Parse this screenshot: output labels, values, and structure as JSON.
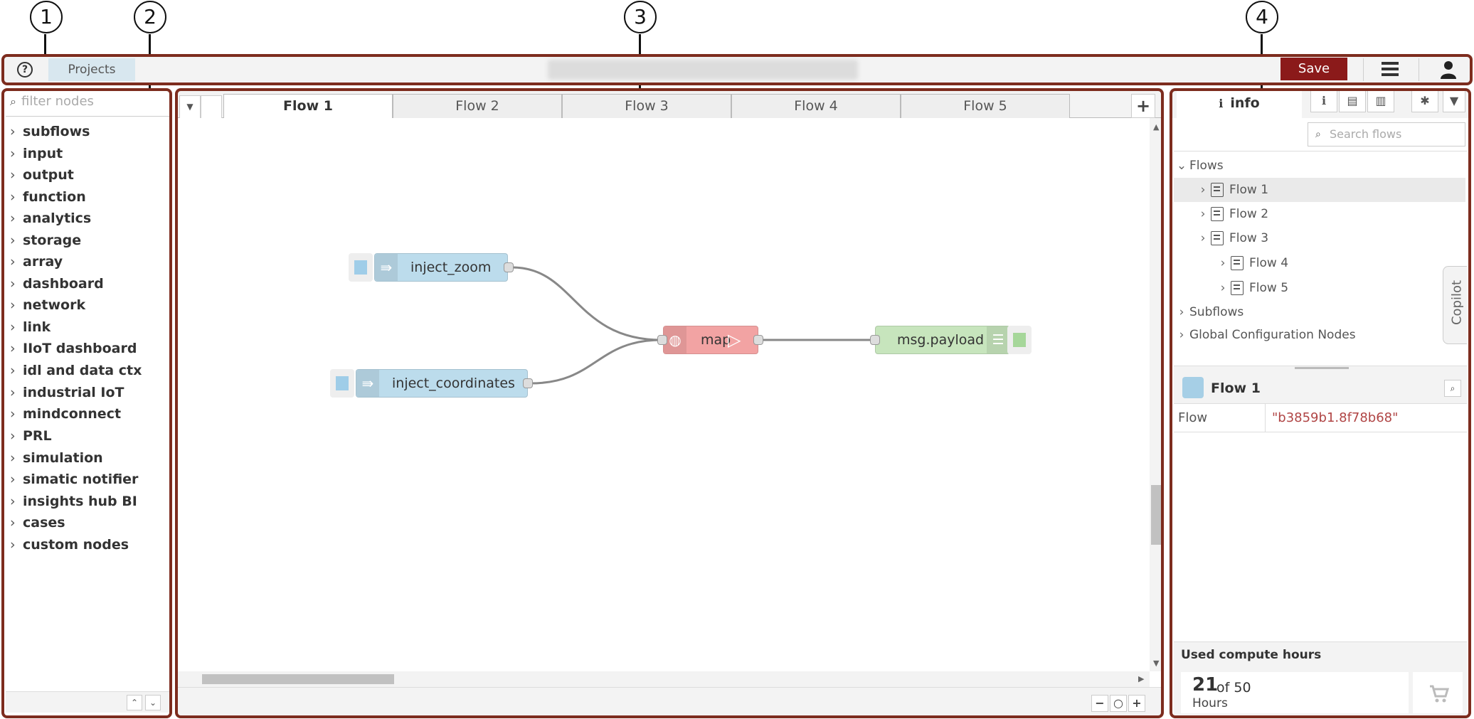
{
  "callouts": [
    "1",
    "2",
    "3",
    "4"
  ],
  "header": {
    "help_icon": "question-circle-icon",
    "projects_label": "Projects",
    "save_label": "Save",
    "menu_icon": "hamburger-menu-icon",
    "user_icon": "user-icon",
    "save_color": "#8b1a1a"
  },
  "palette": {
    "filter_placeholder": "filter nodes",
    "categories": [
      "subflows",
      "input",
      "output",
      "function",
      "analytics",
      "storage",
      "array",
      "dashboard",
      "network",
      "link",
      "IIoT dashboard",
      "idl and data ctx",
      "industrial IoT",
      "mindconnect",
      "PRL",
      "simulation",
      "simatic notifier",
      "insights hub BI",
      "cases",
      "custom nodes"
    ]
  },
  "workspace": {
    "tabs": [
      {
        "label": "Flow 1",
        "active": true
      },
      {
        "label": "Flow 2",
        "active": false
      },
      {
        "label": "Flow 3",
        "active": false
      },
      {
        "label": "Flow 4",
        "active": false
      },
      {
        "label": "Flow 5",
        "active": false
      }
    ],
    "add_tab": "+",
    "nodes": {
      "inject_zoom": "inject_zoom",
      "inject_coordinates": "inject_coordinates",
      "map": "map",
      "debug": "msg.payload"
    },
    "zoom_out": "−",
    "zoom_in": "+"
  },
  "sidebar": {
    "active_tab": "info",
    "search_placeholder": "Search flows",
    "tree": {
      "flows_label": "Flows",
      "flows": [
        "Flow 1",
        "Flow 2",
        "Flow 3",
        "Flow 4",
        "Flow 5"
      ],
      "subflows_label": "Subflows",
      "global_label": "Global Configuration Nodes"
    },
    "copilot_label": "Copilot",
    "selected": {
      "title": "Flow 1",
      "property_key": "Flow",
      "property_value": "\"b3859b1.8f78b68\""
    },
    "usage": {
      "label": "Used compute hours",
      "used": "21",
      "of": "of 50",
      "unit": "Hours"
    }
  }
}
